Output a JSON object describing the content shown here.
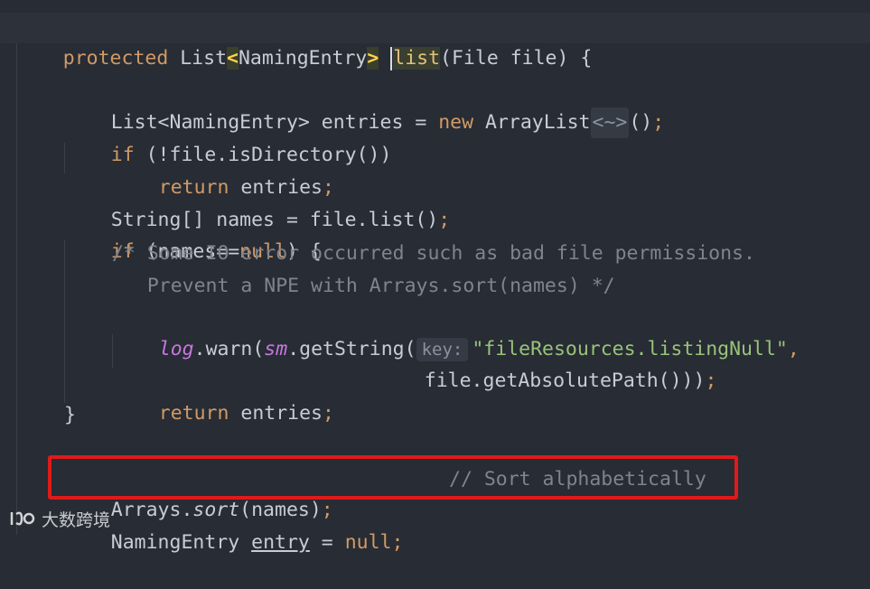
{
  "code": {
    "line_signature": {
      "modifier": "protected",
      "return_type_open": "List",
      "lt": "<",
      "generic": "NamingEntry",
      "gt": ">",
      "method_name": "list",
      "params": "(File file) {"
    },
    "line_entries": {
      "decl": "List<NamingEntry> entries = ",
      "kw_new": "new",
      "ctor": " ArrayList",
      "diamond": "<~>",
      "tail": "()",
      "semi": ";"
    },
    "line_if_dir": {
      "kw_if": "if",
      "rest": " (!file.isDirectory())"
    },
    "line_return1": {
      "kw_return": "return",
      "rest": " entries",
      "semi": ";"
    },
    "line_names": {
      "text": "String[] names = file.list()",
      "semi": ";"
    },
    "line_if_null": {
      "kw_if": "if",
      "open": " (names==",
      "kw_null": "null",
      "close": ") {"
    },
    "comment_1": "/* Some IO error occurred such as bad file permissions.",
    "comment_2": "   Prevent a NPE with Arrays.sort(names) */",
    "line_log": {
      "log": "log",
      "warn": ".warn(",
      "sm": "sm",
      "get": ".getString(",
      "hint": "key:",
      "string": "\"fileResources.listingNull\"",
      "comma": ","
    },
    "line_abs": {
      "text": "file.getAbsolutePath()))",
      "semi": ";"
    },
    "line_return2": {
      "kw_return": "return",
      "rest": " entries",
      "semi": ";"
    },
    "line_close": "}",
    "line_sort": {
      "obj": "Arrays.",
      "method": "sort",
      "args": "(names)",
      "semi": ";",
      "comment": "// Sort alphabetically"
    },
    "line_entry": {
      "type": "NamingEntry ",
      "var": "entry",
      "eq": " = ",
      "kw_null": "null",
      "semi": ";"
    }
  },
  "watermark": {
    "text": "大数跨境"
  },
  "colors": {
    "background": "#282c34",
    "keyword": "#d19a66",
    "string": "#98c379",
    "comment": "#7f848e",
    "italic_field": "#c678dd",
    "highlight_border": "#e01a1a"
  }
}
